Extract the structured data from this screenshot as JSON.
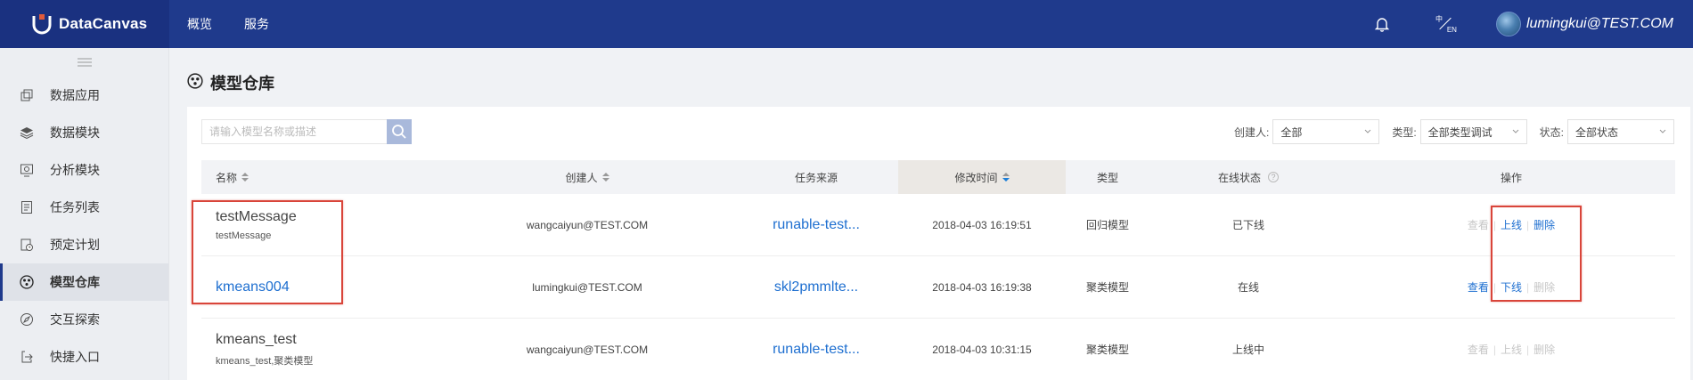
{
  "header": {
    "brand": "DataCanvas",
    "nav": [
      "概览",
      "服务"
    ],
    "lang_zh": "中",
    "lang_en": "EN",
    "user": "lumingkui@TEST.COM"
  },
  "sidebar": {
    "items": [
      {
        "label": "数据应用",
        "icon": "data-app-icon"
      },
      {
        "label": "数据模块",
        "icon": "layers-icon"
      },
      {
        "label": "分析模块",
        "icon": "analysis-icon"
      },
      {
        "label": "任务列表",
        "icon": "task-list-icon"
      },
      {
        "label": "预定计划",
        "icon": "schedule-icon"
      },
      {
        "label": "模型仓库",
        "icon": "model-repo-icon",
        "active": true
      },
      {
        "label": "交互探索",
        "icon": "explore-icon"
      },
      {
        "label": "快捷入口",
        "icon": "shortcut-icon"
      }
    ]
  },
  "page": {
    "title": "模型仓库"
  },
  "search": {
    "placeholder": "请输入模型名称或描述"
  },
  "filters": {
    "creator_label": "创建人:",
    "creator_value": "全部",
    "type_label": "类型:",
    "type_value": "全部类型调试",
    "status_label": "状态:",
    "status_value": "全部状态"
  },
  "table": {
    "columns": [
      "名称",
      "创建人",
      "任务来源",
      "修改时间",
      "类型",
      "在线状态",
      "操作"
    ],
    "rows": [
      {
        "name": "testMessage",
        "desc": "testMessage",
        "creator": "wangcaiyun@TEST.COM",
        "source": "runable-test...",
        "time": "2018-04-03 16:19:51",
        "type": "回归模型",
        "status": "已下线",
        "ops": [
          "查看",
          "上线",
          "删除"
        ]
      },
      {
        "name": "kmeans004",
        "desc": "",
        "creator": "lumingkui@TEST.COM",
        "source": "skl2pmmlte...",
        "time": "2018-04-03 16:19:38",
        "type": "聚类模型",
        "status": "在线",
        "ops": [
          "查看",
          "下线",
          "删除"
        ]
      },
      {
        "name": "kmeans_test",
        "desc": "kmeans_test,聚类模型",
        "creator": "wangcaiyun@TEST.COM",
        "source": "runable-test...",
        "time": "2018-04-03 10:31:15",
        "type": "聚类模型",
        "status": "上线中",
        "ops": [
          "查看",
          "上线",
          "删除"
        ]
      }
    ]
  },
  "colors": {
    "header": "#1f3a8c",
    "link": "#1e6fd0",
    "annotation": "#d9453a"
  }
}
